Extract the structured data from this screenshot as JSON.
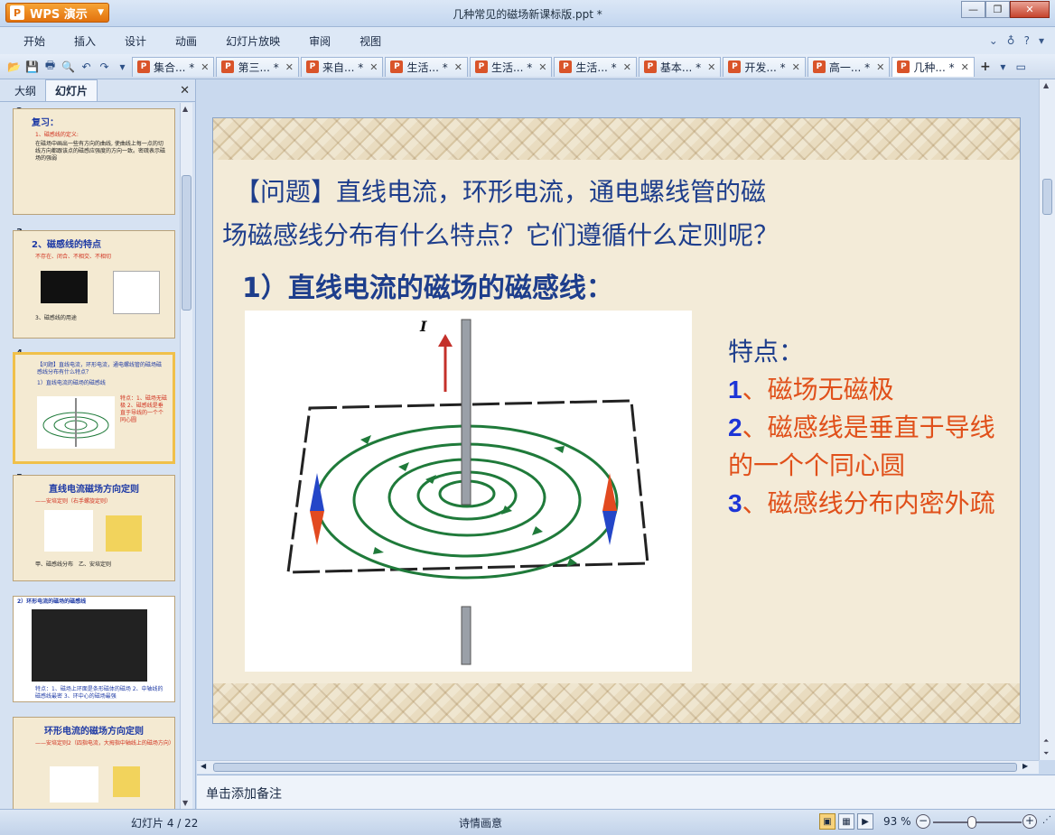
{
  "app": {
    "brand": "WPS 演示",
    "window_title": "几种常见的磁场新课标版.ppt *"
  },
  "menu": [
    "开始",
    "插入",
    "设计",
    "动画",
    "幻灯片放映",
    "审阅",
    "视图"
  ],
  "doc_tabs": [
    "集合... *",
    "第三... *",
    "来自... *",
    "生活... *",
    "生活... *",
    "生活... *",
    "基本... *",
    "开发... *",
    "高一... *",
    "几种... *"
  ],
  "panel": {
    "tab_outline": "大纲",
    "tab_slides": "幻灯片"
  },
  "thumbnails": [
    {
      "num": "2",
      "title": "复习：",
      "line": "1、磁感线的定义:",
      "body": "在磁场中画出一些有方向的曲线, 使曲线上每一点的切线方向都跟该点的磁感应强度的方向一致。密疏表示磁场的强弱"
    },
    {
      "num": "3",
      "title": "2、磁感线的特点",
      "line": "不存在、闭合、不相交、不相切",
      "body": "3、磁感线的用途"
    },
    {
      "num": "4",
      "title": "【问题】直线电流，环形电流，通电螺线管的磁场磁感线分布有什么特点？",
      "line": "1）直线电流的磁场的磁感线",
      "body": "特点：1、磁场无磁极 2、磁感线是垂直于导线的一个个同心圆"
    },
    {
      "num": "5",
      "title": "直线电流磁场方向定则",
      "line": "——安培定则（右手螺旋定则）",
      "body": "甲、磁感线分布　乙、安培定则"
    },
    {
      "num": "6",
      "title": "2）环形电流的磁场的磁感线",
      "line": "",
      "body": "特点：1、磁场上环面是条形磁体的磁场 2、中轴线的磁感线最密 3、环中心的磁场最强"
    },
    {
      "num": "7",
      "title": "环形电流的磁场方向定则",
      "line": "——安培定则2（四指电流，大拇指中轴线上的磁场方向）",
      "body": ""
    }
  ],
  "slide": {
    "question": "【问题】直线电流，环形电流，通电螺线管的磁场磁感线分布有什么特点？它们遵循什么定则呢？",
    "question_line1": "　【问题】直线电流，环形电流，通电螺线管的磁",
    "question_line2": "场磁感线分布有什么特点？它们遵循什么定则呢？",
    "subheading": "1）直线电流的磁场的磁感线：",
    "current_label": "I",
    "features_head": "特点：",
    "features": [
      {
        "num": "1",
        "text": "、磁场无磁极"
      },
      {
        "num": "2",
        "text": "、磁感线是垂直于导线的一个个同心圆"
      },
      {
        "num": "3",
        "text": "、磁感线分布内密外疏"
      }
    ]
  },
  "notes_placeholder": "单击添加备注",
  "status": {
    "slide_counter": "幻灯片 4 / 22",
    "theme": "诗情画意",
    "zoom": "93 %"
  },
  "colors": {
    "accent": "#1e3e8c",
    "highlight": "#e0501a",
    "field_line": "#1f7a3a"
  }
}
